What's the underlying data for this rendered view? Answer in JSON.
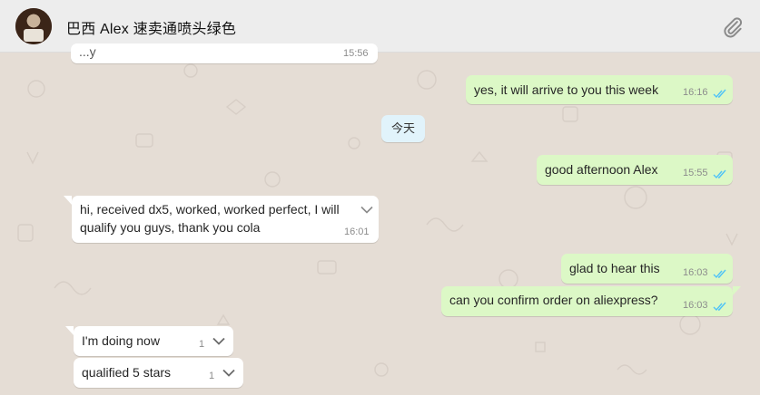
{
  "contact": {
    "name": "巴西 Alex 速卖通喷头绿色"
  },
  "icons": {
    "attach": "paperclip-icon",
    "dropdown": "chevron-down-icon",
    "read": "double-check-icon"
  },
  "colors": {
    "outgoing": "#dcf8c6",
    "incoming": "#ffffff",
    "read_tick": "#4fc3f7",
    "date_chip": "#e1f3fb",
    "background": "#e5ddd5"
  },
  "messages": {
    "m0": {
      "text": "...y",
      "time": "15:56"
    },
    "m1": {
      "text": "yes, it will arrive to you this week",
      "time": "16:16"
    },
    "date": {
      "label": "今天"
    },
    "m2": {
      "text": "good afternoon Alex",
      "time": "15:55"
    },
    "m3": {
      "line1": "hi, received dx5, worked, worked perfect, I will",
      "line2": "qualify you guys, thank you cola",
      "time": "16:01"
    },
    "m4": {
      "text": "glad to hear this",
      "time": "16:03"
    },
    "m5": {
      "text": "can you confirm order on aliexpress?",
      "time": "16:03"
    },
    "m6": {
      "text": "I'm doing now",
      "time": "1"
    },
    "m7": {
      "text": "qualified 5 stars",
      "time": "1"
    }
  }
}
